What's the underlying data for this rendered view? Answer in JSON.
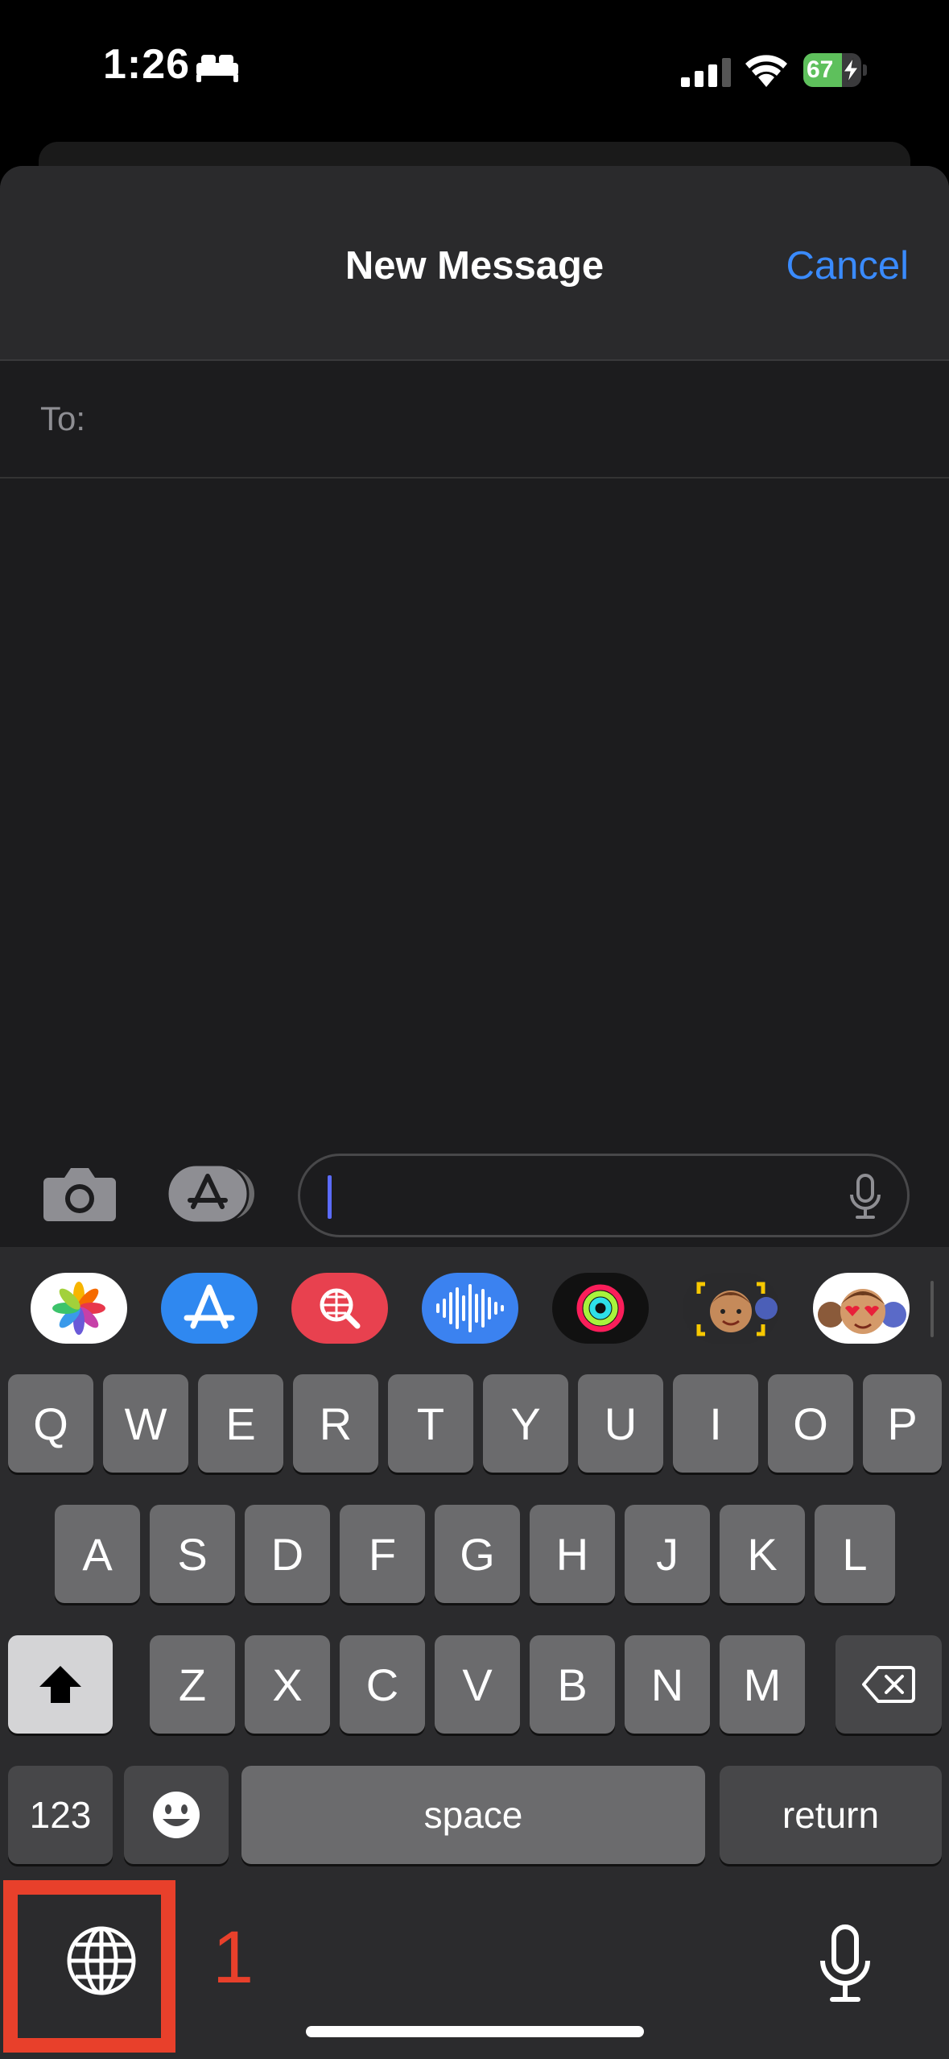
{
  "status_bar": {
    "time": "1:26",
    "battery_percent": "67",
    "battery_level": 0.67,
    "icons": [
      "sleep-icon",
      "cellular-signal-icon",
      "wifi-icon",
      "battery-charging-icon"
    ]
  },
  "header": {
    "title": "New Message",
    "cancel_label": "Cancel"
  },
  "recipient": {
    "label": "To:",
    "value": ""
  },
  "compose": {
    "message_value": "",
    "icons": [
      "camera-icon",
      "app-store-icon",
      "microphone-icon"
    ]
  },
  "app_strip": [
    "photos-app-icon",
    "app-store-app-icon",
    "web-image-search-app-icon",
    "audio-message-app-icon",
    "activity-app-icon",
    "memoji-app-icon",
    "memoji-stickers-app-icon"
  ],
  "keyboard": {
    "row1": [
      "Q",
      "W",
      "E",
      "R",
      "T",
      "Y",
      "U",
      "I",
      "O",
      "P"
    ],
    "row2": [
      "A",
      "S",
      "D",
      "F",
      "G",
      "H",
      "J",
      "K",
      "L"
    ],
    "row3": [
      "Z",
      "X",
      "C",
      "V",
      "B",
      "N",
      "M"
    ],
    "numbers_label": "123",
    "space_label": "space",
    "return_label": "return"
  },
  "annotation": {
    "number": "1",
    "color": "#e8402b"
  },
  "colors": {
    "accent": "#3a8bff",
    "battery_green": "#5ec05c",
    "caret": "#5b6bff"
  }
}
